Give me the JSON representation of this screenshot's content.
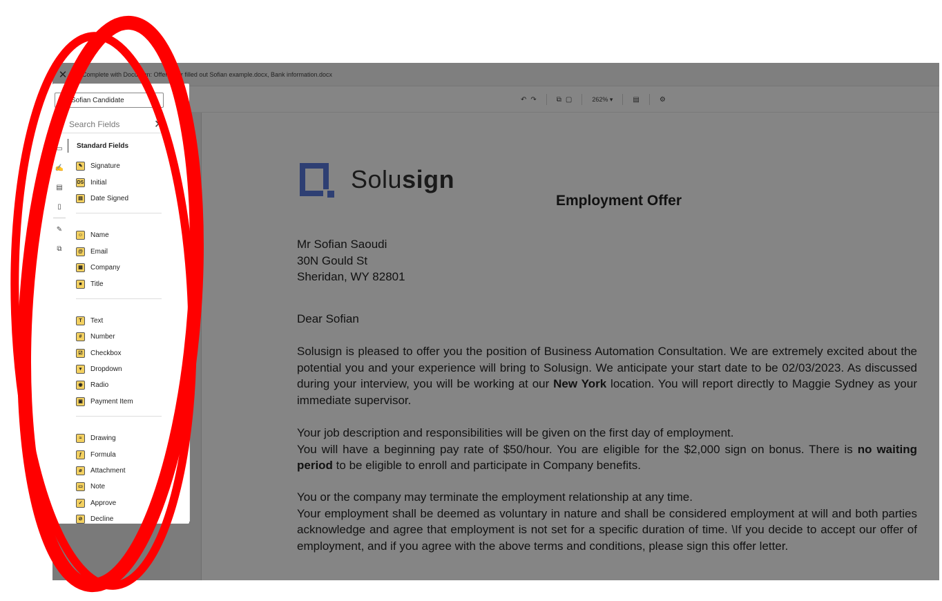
{
  "window": {
    "close_glyph": "✕",
    "title": "Complete with DocuSign: Offer letter filled out Sofian example.docx, Bank information.docx"
  },
  "toolbar": {
    "undo_glyph": "↶",
    "redo_glyph": "↷",
    "copy_glyph": "⧉",
    "paste_glyph": "▢",
    "zoom": "262% ▾",
    "comment_glyph": "▤",
    "fields_glyph": "⚙"
  },
  "panel": {
    "signer": "Sofian Candidate",
    "search_placeholder": "Search Fields",
    "header": "Standard Fields",
    "groups": [
      [
        {
          "label": "Signature",
          "icon": "✎"
        },
        {
          "label": "Initial",
          "icon": "DS"
        },
        {
          "label": "Date Signed",
          "icon": "▤"
        }
      ],
      [
        {
          "label": "Name",
          "icon": "☺"
        },
        {
          "label": "Email",
          "icon": "@"
        },
        {
          "label": "Company",
          "icon": "▦"
        },
        {
          "label": "Title",
          "icon": "■"
        }
      ],
      [
        {
          "label": "Text",
          "icon": "T"
        },
        {
          "label": "Number",
          "icon": "#"
        },
        {
          "label": "Checkbox",
          "icon": "☑"
        },
        {
          "label": "Dropdown",
          "icon": "▾"
        },
        {
          "label": "Radio",
          "icon": "◉"
        },
        {
          "label": "Payment Item",
          "icon": "▣"
        }
      ],
      [
        {
          "label": "Drawing",
          "icon": "≈"
        },
        {
          "label": "Formula",
          "icon": "ƒ"
        },
        {
          "label": "Attachment",
          "icon": "⌀"
        },
        {
          "label": "Note",
          "icon": "▭"
        },
        {
          "label": "Approve",
          "icon": "✓"
        },
        {
          "label": "Decline",
          "icon": "⊘"
        }
      ]
    ]
  },
  "document": {
    "brand_light": "Solu",
    "brand_bold": "sign",
    "title": "Employment Offer",
    "address": [
      "Mr Sofian Saoudi",
      "30N Gould St",
      "Sheridan, WY 82801"
    ],
    "greeting": "Dear Sofian",
    "p1_a": "Solusign is pleased to offer you the position of Business Automation Consultation. We are extremely excited about the potential you and your experience will bring to Solusign. We anticipate your start date to be 02/03/2023. As discussed during your interview, you will be working at our ",
    "p1_bold": "New York",
    "p1_b": " location. You will report directly to Maggie Sydney as your immediate supervisor.",
    "p2_a": "Your job description and responsibilities will be given on the first day of employment.",
    "p2_b": "You will have a beginning pay rate of $50/hour. You are eligible for the $2,000 sign on bonus. There is ",
    "p2_bold": "no waiting period",
    "p2_c": " to be eligible to enroll and participate in Company benefits.",
    "p3_a": "You or the company may terminate the employment relationship at any time.",
    "p3_b": "Your employment shall be deemed as voluntary in nature and shall be considered employment at will and both parties acknowledge and agree that employment is not set for a specific duration of time. \\If you decide to accept our offer of employment, and if you agree with the above terms and conditions, please sign this offer letter."
  },
  "annotation_color": "#ff0000"
}
